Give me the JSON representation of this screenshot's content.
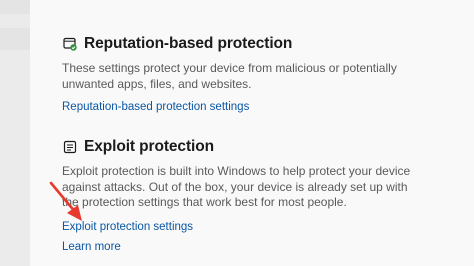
{
  "reputation": {
    "title": "Reputation-based protection",
    "description": "These settings protect your device from malicious or potentially unwanted apps, files, and websites.",
    "link": "Reputation-based protection settings",
    "icon": "app-browser-control-icon"
  },
  "exploit": {
    "title": "Exploit protection",
    "description": "Exploit protection is built into Windows to help protect your device against attacks.  Out of the box, your device is already set up with the protection settings that work best for most people.",
    "settings_link": "Exploit protection settings",
    "learn_more": "Learn more",
    "icon": "exploit-protection-icon"
  },
  "colors": {
    "link": "#0b57a4",
    "annotation_arrow": "#e8392e",
    "icon_accent": "#2f8f3a"
  }
}
